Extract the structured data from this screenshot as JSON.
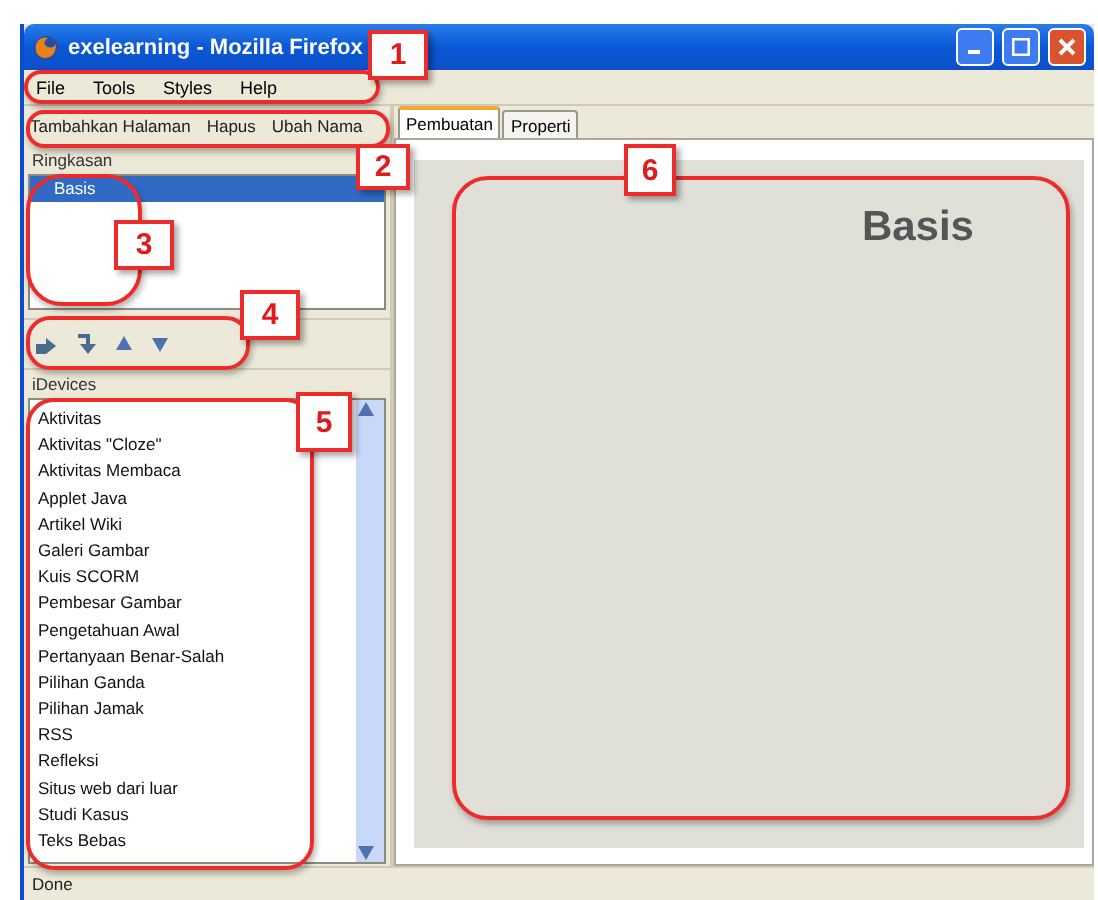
{
  "window": {
    "title": "exelearning - Mozilla Firefox"
  },
  "menu": [
    "File",
    "Tools",
    "Styles",
    "Help"
  ],
  "outline_toolbar": [
    "Tambahkan Halaman",
    "Hapus",
    "Ubah Nama"
  ],
  "outline": {
    "label": "Ringkasan",
    "items": [
      {
        "label": "Basis",
        "selected": true
      }
    ]
  },
  "tabs": [
    {
      "label": "Pembuatan",
      "selected": true
    },
    {
      "label": "Properti",
      "selected": false
    }
  ],
  "idevices": {
    "label": "iDevices",
    "items": [
      "Aktivitas",
      "Aktivitas \"Cloze\"",
      "Aktivitas Membaca",
      "Applet Java",
      "Artikel Wiki",
      "Galeri Gambar",
      "Kuis SCORM",
      "Pembesar Gambar",
      "Pengetahuan Awal",
      "Pertanyaan Benar-Salah",
      "Pilihan Ganda",
      "Pilihan Jamak",
      "RSS",
      "Refleksi",
      "Situs web dari luar",
      "Studi Kasus",
      "Teks Bebas"
    ]
  },
  "content": {
    "page_title": "Basis"
  },
  "status_bar": "Done",
  "callouts": [
    {
      "number": "1"
    },
    {
      "number": "2"
    },
    {
      "number": "3"
    },
    {
      "number": "4"
    },
    {
      "number": "5"
    },
    {
      "number": "6"
    }
  ]
}
